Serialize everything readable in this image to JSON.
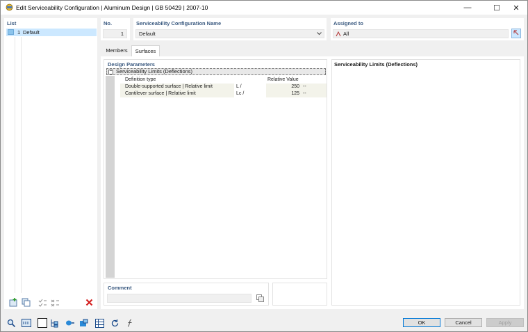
{
  "window": {
    "title": "Edit Serviceability Configuration | Aluminum Design | GB 50429 | 2007-10",
    "minimize_glyph": "—",
    "maximize_glyph": "☐",
    "close_glyph": "✕"
  },
  "list": {
    "label": "List",
    "items": [
      {
        "number": "1",
        "name": "Default"
      }
    ]
  },
  "number": {
    "label": "No.",
    "value": "1"
  },
  "config_name": {
    "label": "Serviceability Configuration Name",
    "value": "Default"
  },
  "assigned": {
    "label": "Assigned to",
    "value": "All"
  },
  "tabs": [
    {
      "label": "Members"
    },
    {
      "label": "Surfaces"
    }
  ],
  "design_params": {
    "label": "Design Parameters",
    "group": "Serviceability Limits (Deflections)",
    "collapse_glyph": "−",
    "columns": {
      "definition": "Definition type",
      "value": "Relative Value"
    },
    "rows": [
      {
        "name": "Double-supported surface | Relative limit",
        "symbol": "L /",
        "value": "250",
        "unit": "--"
      },
      {
        "name": "Cantilever surface | Relative limit",
        "symbol": "Lc /",
        "value": "125",
        "unit": "--"
      }
    ]
  },
  "info_panel": {
    "title": "Serviceability Limits (Deflections)"
  },
  "comment": {
    "label": "Comment",
    "value": ""
  },
  "buttons": {
    "ok": "OK",
    "cancel": "Cancel",
    "apply": "Apply"
  },
  "icons": [
    "new-item-icon",
    "copy-item-icon",
    "check-all-icon",
    "uncheck-all-icon",
    "delete-icon",
    "search-icon",
    "units-icon",
    "color-icon",
    "tree-view-icon",
    "filter-icon",
    "display-icon",
    "table-icon",
    "reset-icon",
    "formula-icon",
    "copy-comment-icon",
    "assign-pick-icon"
  ],
  "colors": {
    "accent": "#3b5a80",
    "selection": "#cce8ff",
    "delete": "#d42020",
    "primary_border": "#0078d7"
  }
}
